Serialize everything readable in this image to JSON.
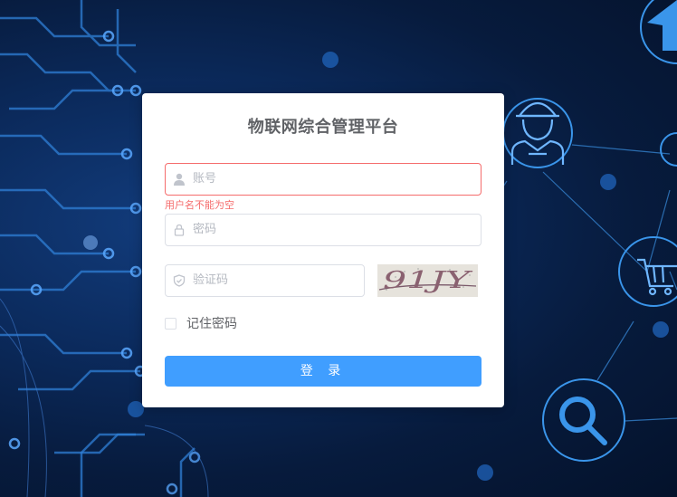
{
  "login": {
    "title": "物联网综合管理平台",
    "username": {
      "placeholder": "账号",
      "value": "",
      "error": "用户名不能为空"
    },
    "password": {
      "placeholder": "密码",
      "value": ""
    },
    "captcha": {
      "placeholder": "验证码",
      "value": "",
      "image_text": "91JY"
    },
    "remember": {
      "label": "记住密码",
      "checked": false
    },
    "submit_label": "登 录"
  },
  "icons": {
    "username": "user-icon",
    "password": "lock-icon",
    "captcha": "shield-icon",
    "background": [
      "home-icon",
      "engineer-icon",
      "cart-icon",
      "search-icon"
    ]
  },
  "colors": {
    "primary": "#409eff",
    "error": "#f56c6c",
    "background": "#071b3d"
  }
}
